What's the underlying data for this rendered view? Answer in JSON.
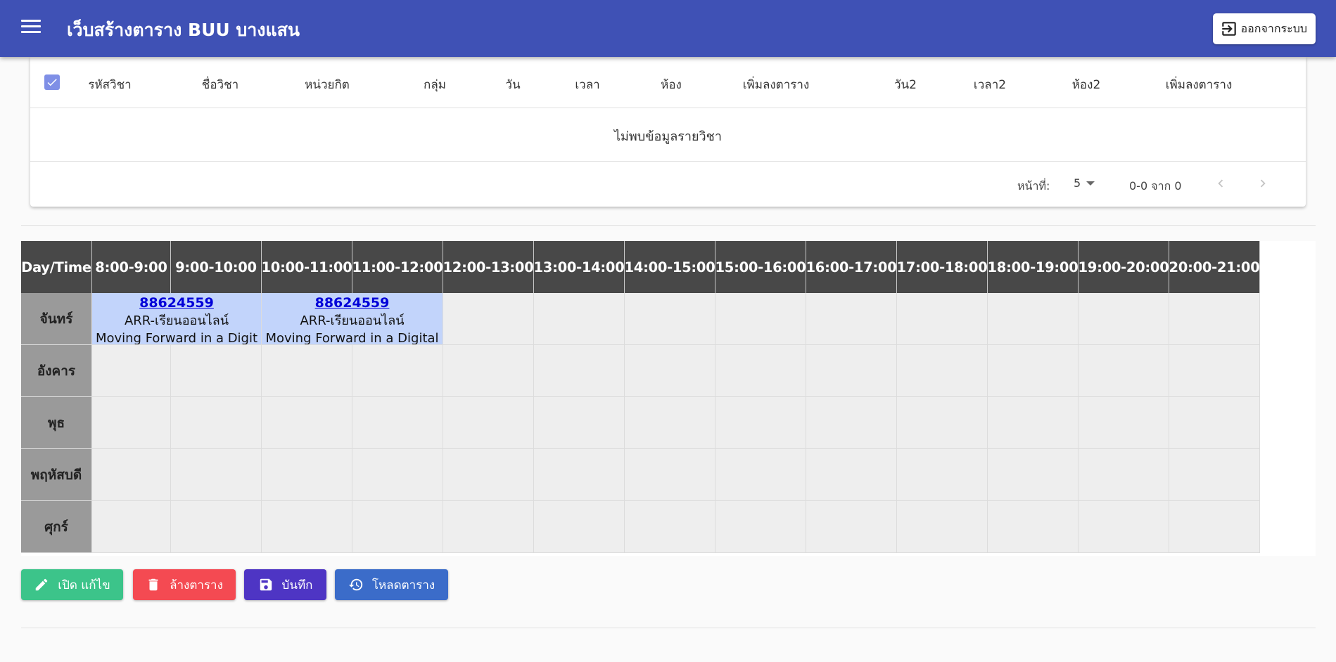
{
  "app": {
    "title": "เว็บสร้างตาราง BUU บางแสน",
    "logout_label": "ออกจากระบบ"
  },
  "course_table": {
    "headers": [
      "รหัสวิชา",
      "ชื่อวิชา",
      "หน่วยกิต",
      "กลุ่ม",
      "วัน",
      "เวลา",
      "ห้อง",
      "เพิ่มลงตาราง",
      "วัน2",
      "เวลา2",
      "ห้อง2",
      "เพิ่มลงตาราง"
    ],
    "select_all_checked": true,
    "empty_message": "ไม่พบข้อมูลรายวิชา",
    "pagination": {
      "rows_per_page_label": "หน้าที่:",
      "rows_per_page": "5",
      "range": "0-0 จาก 0"
    }
  },
  "timetable": {
    "corner": "Day/Time",
    "times": [
      "8:00-9:00",
      "9:00-10:00",
      "10:00-11:00",
      "11:00-12:00",
      "12:00-13:00",
      "13:00-14:00",
      "14:00-15:00",
      "15:00-16:00",
      "16:00-17:00",
      "17:00-18:00",
      "18:00-19:00",
      "19:00-20:00",
      "20:00-21:00"
    ],
    "days": [
      "จันทร์",
      "อังคาร",
      "พุธ",
      "พฤหัสบดี",
      "ศุกร์"
    ],
    "entries": [
      {
        "day": 0,
        "start": 0,
        "span": 2,
        "code": "88624559",
        "room": "ARR-เรียนออนไลน์",
        "name": "Moving Forward in a Digit"
      },
      {
        "day": 0,
        "start": 2,
        "span": 2,
        "code": "88624559",
        "room": "ARR-เรียนออนไลน์",
        "name": "Moving Forward in a Digital"
      }
    ],
    "colors": {
      "header": "#484848",
      "day": "#9a9a9a",
      "slot": "#eeeeee",
      "course": "#c2d4fb"
    }
  },
  "actions": {
    "edit": {
      "label": "เปิด แก้ไข",
      "color": "#3cc48a",
      "icon": "pencil-icon"
    },
    "clear": {
      "label": "ล้างตาราง",
      "color": "#f44a52",
      "icon": "trash-icon"
    },
    "save": {
      "label": "บันทึก",
      "color": "#4e35c4",
      "icon": "floppy-icon"
    },
    "load": {
      "label": "โหลดตาราง",
      "color": "#3b6cc9",
      "icon": "history-icon"
    }
  }
}
